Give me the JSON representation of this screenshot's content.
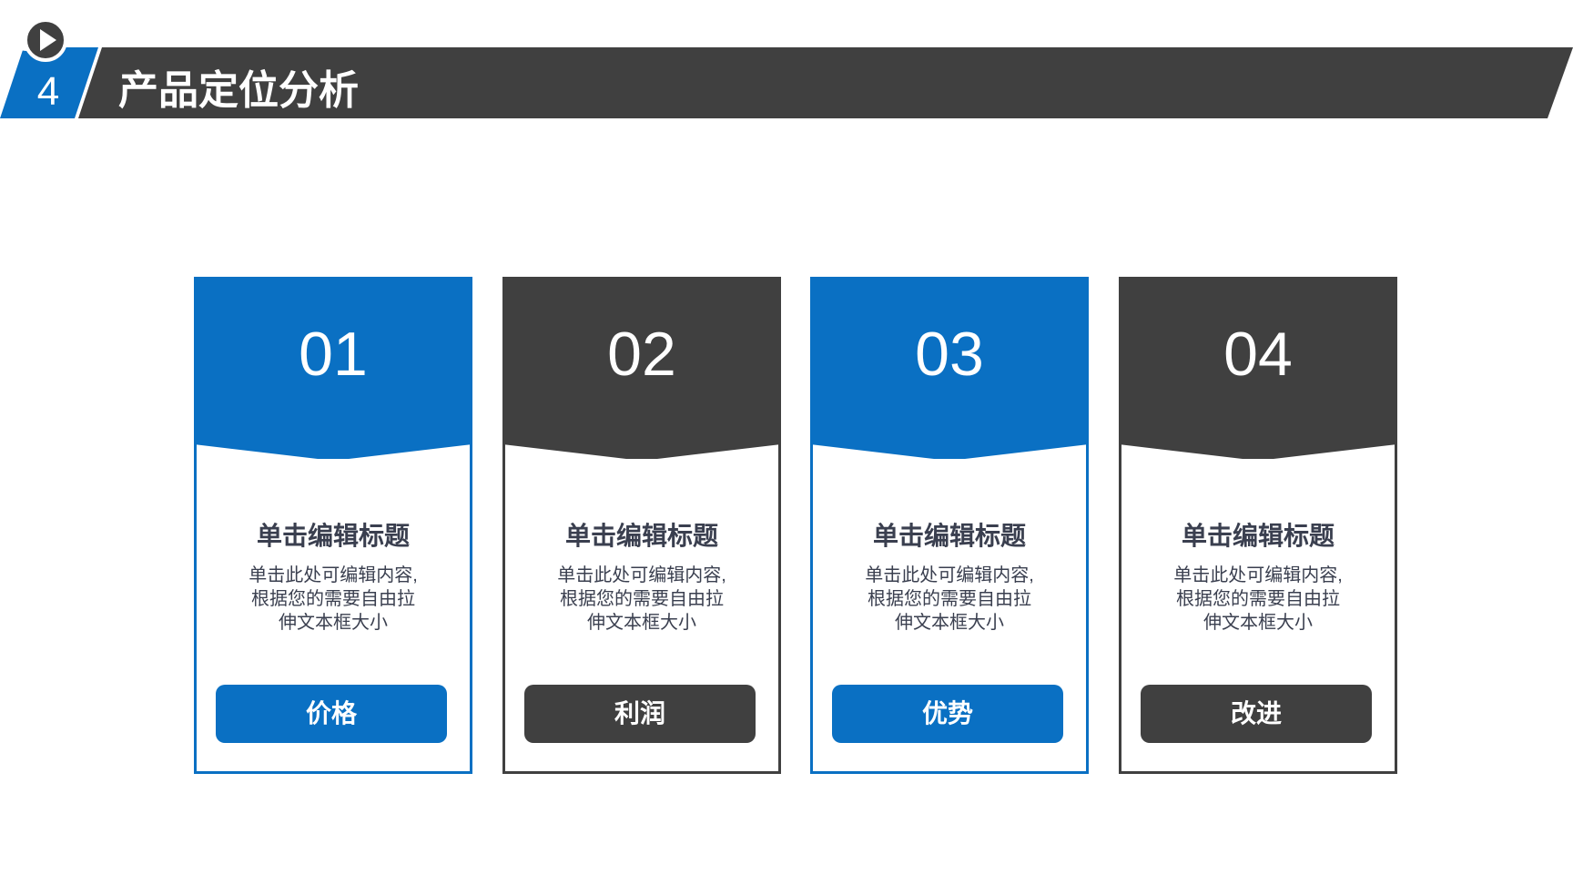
{
  "header": {
    "section_number": "4",
    "title": "产品定位分析",
    "icon": "play-circle-double-icon"
  },
  "colors": {
    "accent_blue": "#0a70c3",
    "dark_gray": "#404040",
    "text": "#3a3f4f"
  },
  "cards": [
    {
      "number": "01",
      "heading": "单击编辑标题",
      "desc": [
        "单击此处可编辑内容,",
        "根据您的需要自由拉",
        "伸文本框大小"
      ],
      "button": "价格",
      "theme": "blue"
    },
    {
      "number": "02",
      "heading": "单击编辑标题",
      "desc": [
        "单击此处可编辑内容,",
        "根据您的需要自由拉",
        "伸文本框大小"
      ],
      "button": "利润",
      "theme": "dark"
    },
    {
      "number": "03",
      "heading": "单击编辑标题",
      "desc": [
        "单击此处可编辑内容,",
        "根据您的需要自由拉",
        "伸文本框大小"
      ],
      "button": "优势",
      "theme": "blue"
    },
    {
      "number": "04",
      "heading": "单击编辑标题",
      "desc": [
        "单击此处可编辑内容,",
        "根据您的需要自由拉",
        "伸文本框大小"
      ],
      "button": "改进",
      "theme": "dark"
    }
  ]
}
